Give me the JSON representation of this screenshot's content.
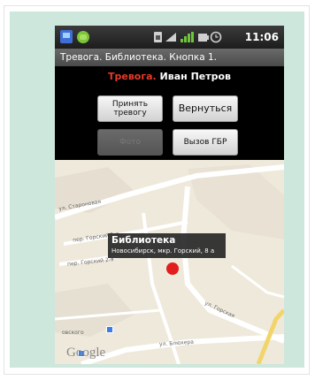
{
  "status_bar": {
    "time": "11:06"
  },
  "title_bar": {
    "title": "Тревога. Библиотека. Кнопка 1."
  },
  "header": {
    "alarm_word": "Тревога.",
    "person_name": "Иван Петров"
  },
  "buttons": {
    "accept_label": "Принять тревогу",
    "return_label": "Вернуться",
    "photo_label": "Фото",
    "call_label": "Вызов ГБР"
  },
  "map": {
    "place_title": "Библиотека",
    "place_address": "Новосибирск, мкр. Горский, 8 а",
    "attribution": "Google",
    "street_labels": {
      "s1": "ул. Староновая",
      "s2": "пер. Горский 1-я",
      "s3": "пер. Горский 2-я",
      "s4": "ул. Горская",
      "s5": "ул. Блюхера",
      "s6": "овского"
    }
  },
  "colors": {
    "mint_background": "#cde7dc",
    "alarm_red": "#e83a2a",
    "marker_red": "#e21d1d"
  },
  "icons": [
    "app-icon",
    "android-icon",
    "sim-icon",
    "wifi-icon",
    "signal-icon",
    "battery-icon",
    "alarm-clock-icon"
  ]
}
